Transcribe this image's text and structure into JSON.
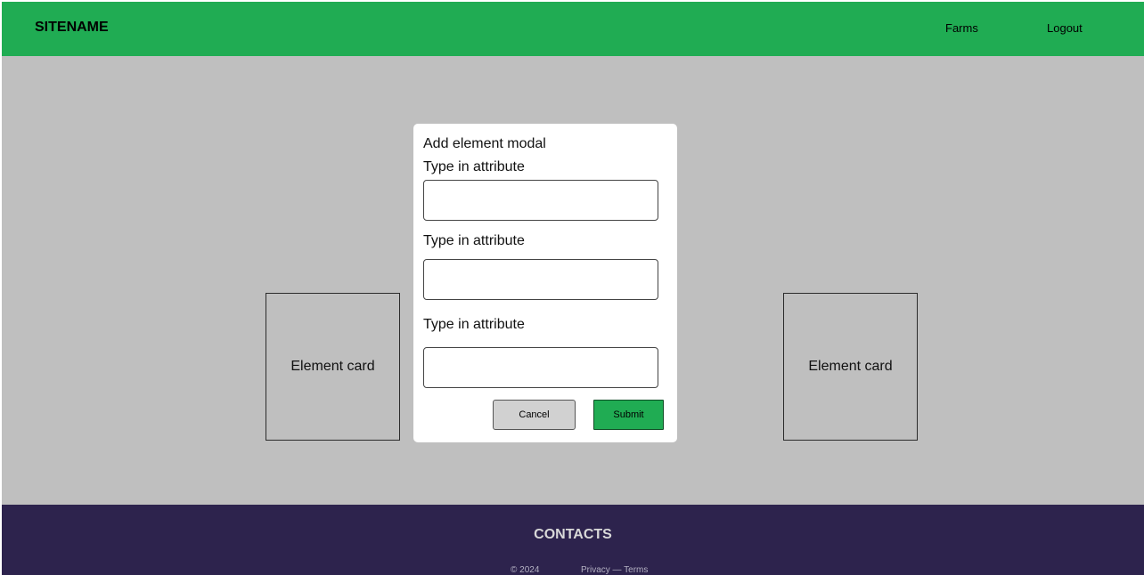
{
  "header": {
    "brand": "SITENAME",
    "nav": {
      "farms": "Farms",
      "logout": "Logout"
    },
    "color": "#20ac53"
  },
  "main": {
    "background": "#bfbfbf",
    "cards": [
      {
        "label": "Element card"
      },
      {
        "label": "Element card"
      }
    ]
  },
  "modal": {
    "title": "Add element modal",
    "fields": [
      {
        "label": "Type in attribute",
        "value": "",
        "placeholder": ""
      },
      {
        "label": "Type in attribute",
        "value": "",
        "placeholder": ""
      },
      {
        "label": "Type in attribute",
        "value": "",
        "placeholder": ""
      }
    ],
    "cancel_label": "Cancel",
    "submit_label": "Submit"
  },
  "footer": {
    "title": "CONTACTS",
    "copyright": "© 2024",
    "links": "Privacy — Terms",
    "color": "#2d234d"
  }
}
